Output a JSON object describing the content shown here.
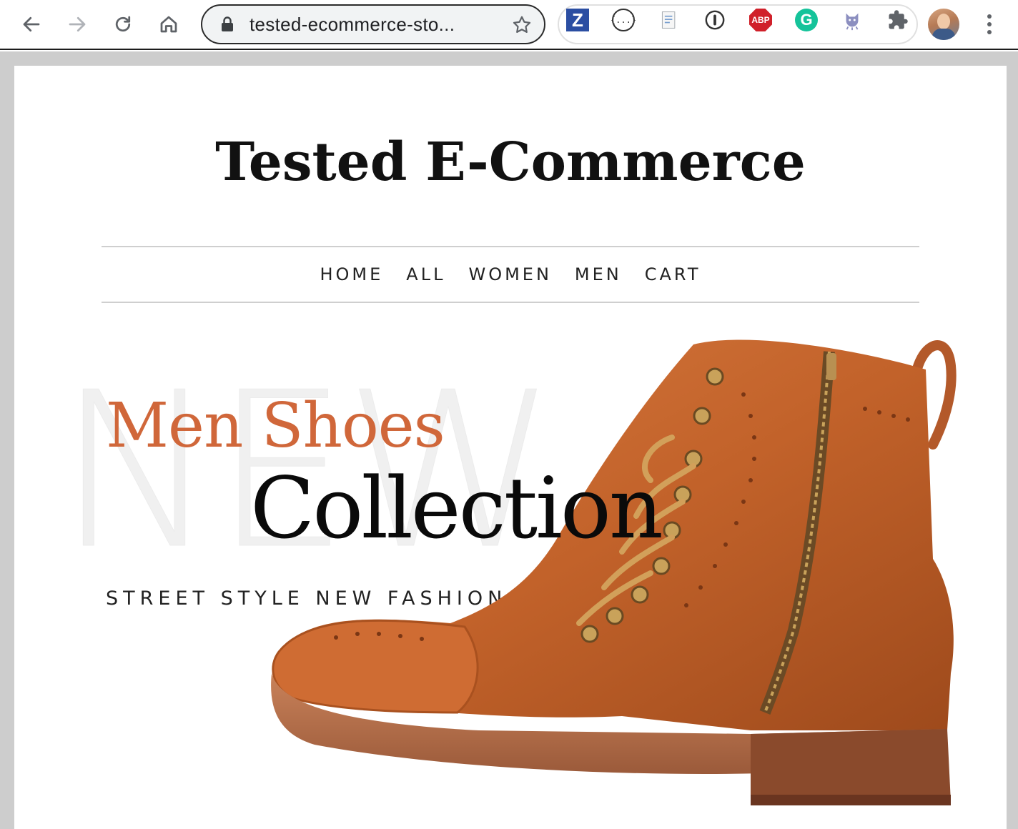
{
  "browser": {
    "url": "tested-ecommerce-sto...",
    "extensions": [
      "Z",
      "{...}",
      "ABP",
      "G"
    ],
    "colors": {
      "zotero": "#2b4ea2",
      "abp": "#d0202a",
      "grammarly": "#15c39a"
    }
  },
  "site": {
    "title": "Tested E-Commerce",
    "nav": [
      "HOME",
      "ALL",
      "WOMEN",
      "MEN",
      "CART"
    ]
  },
  "hero": {
    "background_word": "NEW",
    "subtitle": "Men Shoes",
    "title": "Collection",
    "tagline": "STREET STYLE NEW FASHION",
    "accent_color": "#d0673a"
  }
}
